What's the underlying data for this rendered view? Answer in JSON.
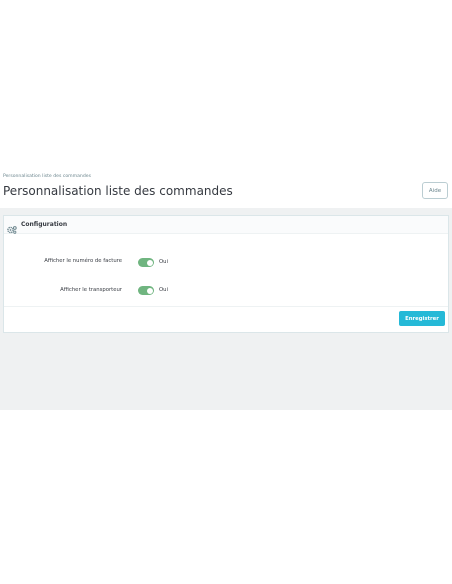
{
  "header": {
    "breadcrumb": "Personnalisation liste des commandes",
    "title": "Personnalisation liste des commandes",
    "help_label": "Aide"
  },
  "card": {
    "title": "Configuration",
    "icon": "cogs-icon",
    "rows": [
      {
        "label": "Afficher le numéro de facture",
        "toggle_value": "Oui",
        "enabled": true
      },
      {
        "label": "Afficher le transporteur",
        "toggle_value": "Oui",
        "enabled": true
      }
    ],
    "save_label": "Enregistrer"
  },
  "colors": {
    "accent": "#25b9d7",
    "switch_on": "#70b580",
    "content_bg": "#eff1f2"
  }
}
